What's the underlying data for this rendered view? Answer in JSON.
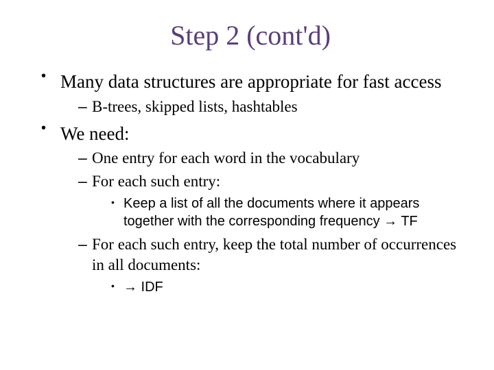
{
  "title": "Step 2 (cont'd)",
  "bullets": [
    {
      "text": "Many data structures are appropriate for fast access",
      "sub": [
        {
          "text": "B-trees, skipped lists, hashtables"
        }
      ]
    },
    {
      "text": "We need:",
      "sub": [
        {
          "text": "One entry for each word in the vocabulary"
        },
        {
          "text": "For each such entry:",
          "sub": [
            {
              "text": "Keep a list of all the documents where it appears together with the corresponding frequency → TF"
            }
          ]
        },
        {
          "text": "For each such entry, keep the total number of occurrences in all documents:",
          "sub": [
            {
              "text": "→ IDF"
            }
          ]
        }
      ]
    }
  ]
}
